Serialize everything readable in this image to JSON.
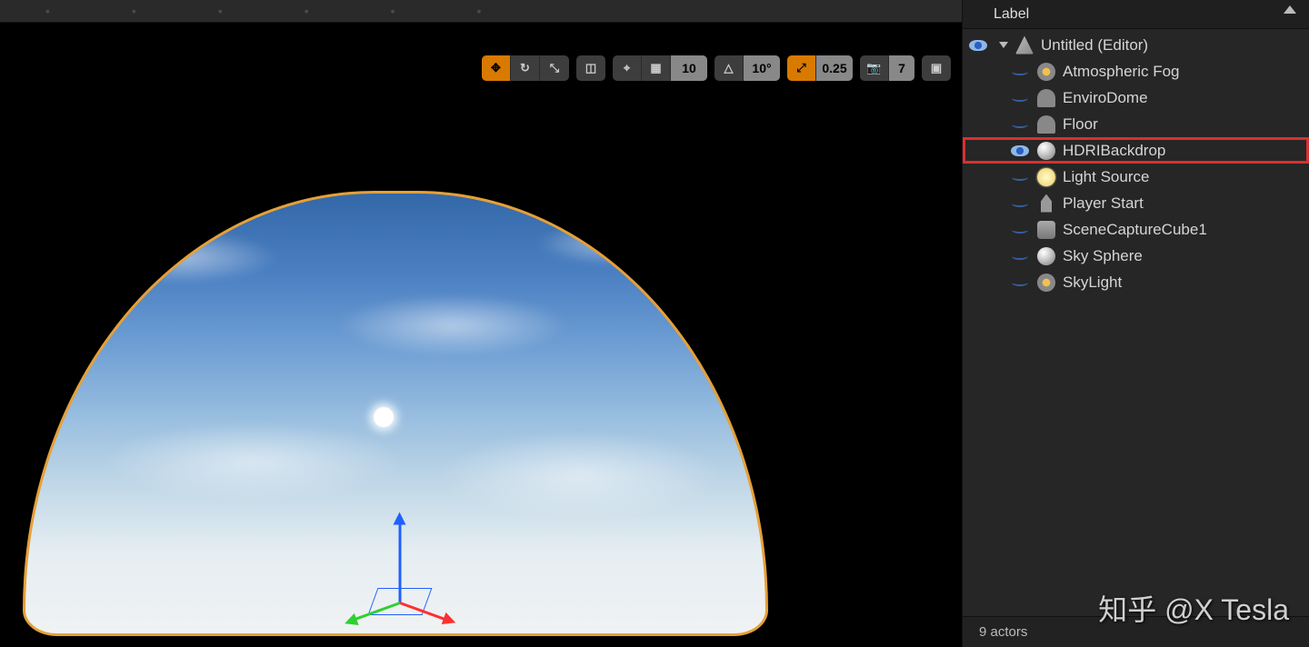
{
  "viewport_toolbar": {
    "snap_distance": "10",
    "snap_angle": "10°",
    "camera_speed_scale": "0.25",
    "camera_speed": "7"
  },
  "outliner": {
    "header": "Label",
    "root": {
      "label": "Untitled (Editor)",
      "visible": true
    },
    "items": [
      {
        "label": "Atmospheric Fog",
        "icon": "fog",
        "visible": false
      },
      {
        "label": "EnviroDome",
        "icon": "dome",
        "visible": false
      },
      {
        "label": "Floor",
        "icon": "dome",
        "visible": false
      },
      {
        "label": "HDRIBackdrop",
        "icon": "sphere",
        "visible": true,
        "highlighted": true
      },
      {
        "label": "Light Source",
        "icon": "light",
        "visible": false
      },
      {
        "label": "Player Start",
        "icon": "player",
        "visible": false
      },
      {
        "label": "SceneCaptureCube1",
        "icon": "capture",
        "visible": false
      },
      {
        "label": "Sky Sphere",
        "icon": "sphere",
        "visible": false
      },
      {
        "label": "SkyLight",
        "icon": "fog",
        "visible": false
      }
    ],
    "footer": "9 actors"
  },
  "watermark": "知乎 @X Tesla"
}
